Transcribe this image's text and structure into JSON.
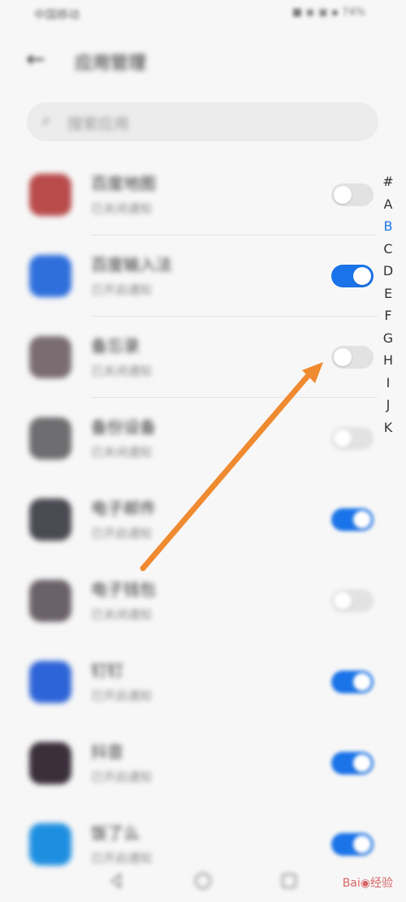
{
  "status_bar": {
    "left": "中国移动",
    "right": "■ ◉ ▣ ▪ 74%"
  },
  "header": {
    "title": "应用管理"
  },
  "search": {
    "placeholder": "搜索应用"
  },
  "apps": [
    {
      "name": "百度地图",
      "sub": "已关闭通知",
      "icon": "map-icon",
      "color": "#b94b4b",
      "enabled": false
    },
    {
      "name": "百度输入法",
      "sub": "已开启通知",
      "icon": "keyboard-icon",
      "color": "#2e6fdc",
      "enabled": true
    },
    {
      "name": "备忘录",
      "sub": "已关闭通知",
      "icon": "notes-icon",
      "color": "#7a6d72",
      "enabled": false
    },
    {
      "name": "备份设备",
      "sub": "已关闭通知",
      "icon": "backup-icon",
      "color": "#6e6e70",
      "enabled": false
    },
    {
      "name": "电子邮件",
      "sub": "已开启通知",
      "icon": "mail-icon",
      "color": "#4a4a52",
      "enabled": true
    },
    {
      "name": "电子钱包",
      "sub": "已关闭通知",
      "icon": "wallet-icon",
      "color": "#6a6268",
      "enabled": false
    },
    {
      "name": "钉钉",
      "sub": "已开启通知",
      "icon": "dingtalk-icon",
      "color": "#2d64d8",
      "enabled": true
    },
    {
      "name": "抖音",
      "sub": "已开启通知",
      "icon": "tiktok-icon",
      "color": "#3a2f3a",
      "enabled": true
    },
    {
      "name": "饭了么",
      "sub": "已开启通知",
      "icon": "food-icon",
      "color": "#1e8fe0",
      "enabled": true
    }
  ],
  "index_letters": [
    "#",
    "A",
    "B",
    "C",
    "D",
    "E",
    "F",
    "G",
    "H",
    "I",
    "J",
    "K"
  ],
  "index_active": "B",
  "colors": {
    "accent": "#1a73e8",
    "arrow": "#f08a30"
  },
  "nav": {
    "back": "back-icon",
    "home": "home-icon",
    "recent": "recent-icon"
  },
  "watermark": "Bai◉经验"
}
